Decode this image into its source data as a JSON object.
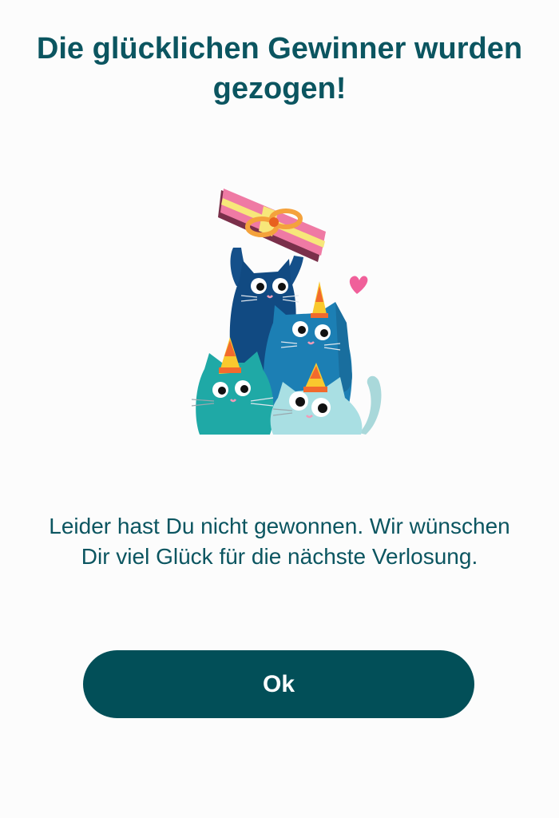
{
  "dialog": {
    "title": "Die glücklichen Gewinner wurden gezogen!",
    "message": "Leider hast Du nicht gewonnen. Wir wünschen Dir viel Glück für die nächste Verlosung.",
    "ok_label": "Ok"
  },
  "illustration": {
    "icon": "party-cats-with-gift-illustration"
  },
  "colors": {
    "text": "#0b5560",
    "button": "#024f58",
    "button_text": "#ffffff",
    "background": "#fcfcfc"
  }
}
